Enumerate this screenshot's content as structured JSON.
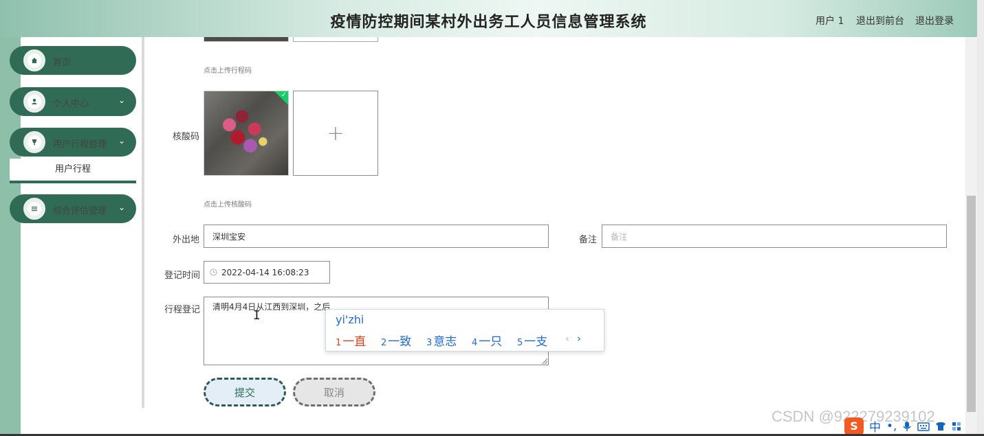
{
  "header": {
    "title": "疫情防控期间某村外出务工人员信息管理系统",
    "user": "用户 1",
    "front_link": "退出到前台",
    "logout_link": "退出登录"
  },
  "sidebar": {
    "items": [
      {
        "label": "首页",
        "icon": "home-icon"
      },
      {
        "label": "个人中心",
        "icon": "user-icon",
        "chevron": "⌄"
      },
      {
        "label": "用户行程管理",
        "icon": "pin-icon",
        "chevron": "⌄",
        "submenu": [
          "用户行程"
        ]
      },
      {
        "label": "综合评估管理",
        "icon": "list-icon",
        "chevron": "⌄"
      }
    ],
    "accent_color": "#2f6b55"
  },
  "form": {
    "upload_trip_hint": "点击上传行程码",
    "nucleic_label": "核酸码",
    "upload_nucleic_hint": "点击上传核酸码",
    "plus": "+",
    "destination_label": "外出地",
    "destination_value": "深圳宝安",
    "remark_label": "备注",
    "remark_placeholder": "备注",
    "time_label": "登记时间",
    "time_value": "2022-04-14 16:08:23",
    "trip_label": "行程登记",
    "trip_value": "清明4月4日从江西到深圳，之后",
    "submit": "提交",
    "cancel": "取消"
  },
  "ime": {
    "pinyin": "yi'zhi",
    "candidates": [
      {
        "num": "1",
        "text": "一直"
      },
      {
        "num": "2",
        "text": "一致"
      },
      {
        "num": "3",
        "text": "意志"
      },
      {
        "num": "4",
        "text": "一只"
      },
      {
        "num": "5",
        "text": "一支"
      }
    ],
    "prev": "‹",
    "next": "›",
    "toolbar": {
      "logo": "S",
      "mode": "中",
      "punct": "•,"
    }
  },
  "watermark": "CSDN @922279239102"
}
